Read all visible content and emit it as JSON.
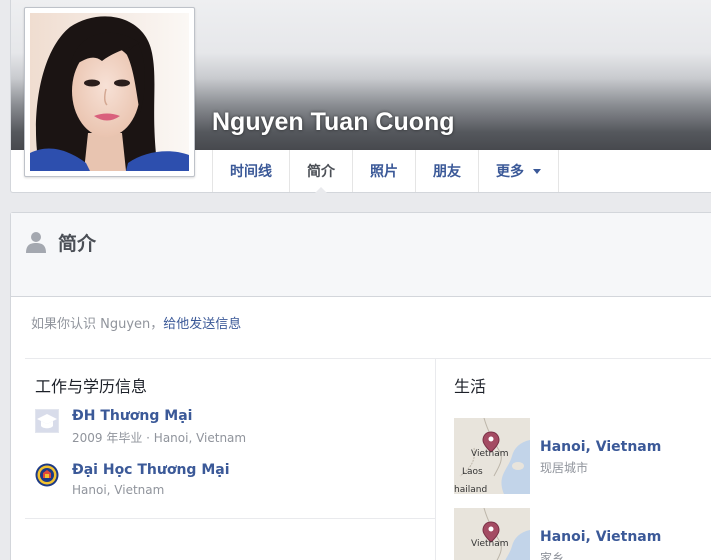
{
  "profile": {
    "name": "Nguyen Tuan Cuong"
  },
  "nav": {
    "tabs": [
      {
        "label": "时间线"
      },
      {
        "label": "简介"
      },
      {
        "label": "照片"
      },
      {
        "label": "朋友"
      },
      {
        "label": "更多"
      }
    ],
    "active": "简介"
  },
  "about": {
    "title": "简介",
    "know_prefix": "如果你认识 Nguyen，",
    "know_link": "给他发送信息"
  },
  "work_education": {
    "title": "工作与学历信息",
    "items": [
      {
        "name": "ĐH Thương Mại",
        "details": "2009 年毕业 · Hanoi, Vietnam"
      },
      {
        "name": "Đại Học Thương Mại",
        "details": "Hanoi, Vietnam"
      }
    ]
  },
  "living": {
    "title": "生活",
    "items": [
      {
        "name": "Hanoi, Vietnam",
        "details": "现居城市"
      },
      {
        "name": "Hanoi, Vietnam",
        "details": "家乡"
      }
    ]
  },
  "map_labels": {
    "vietnam": "Vietnam",
    "laos": "Laos",
    "thailand": "hailand"
  },
  "colors": {
    "link_blue": "#3b5998",
    "map_pin": "#a44b63",
    "page_bg": "#e9eaed"
  }
}
